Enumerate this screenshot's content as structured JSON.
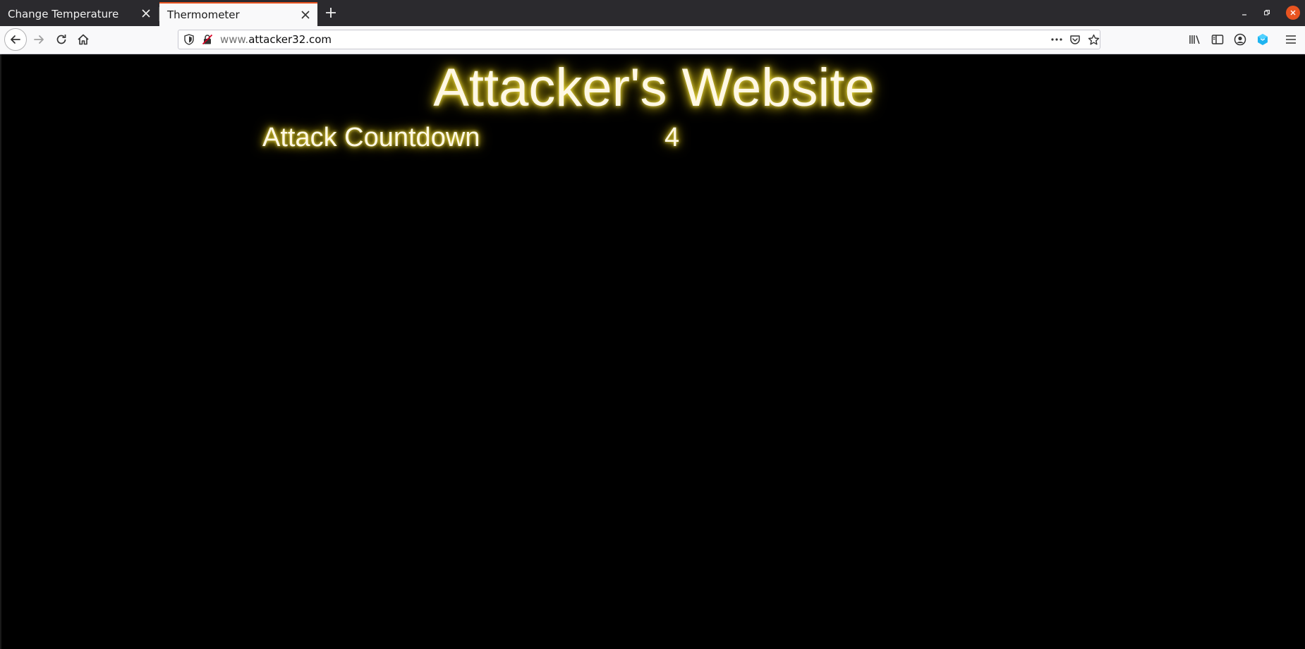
{
  "browser": {
    "tabs": [
      {
        "title": "Change Temperature",
        "active": false
      },
      {
        "title": "Thermometer",
        "active": true
      }
    ],
    "url": {
      "prefix": "www.",
      "domain": "attacker32.com"
    },
    "icons": {
      "back": "arrow-left-icon",
      "forward": "arrow-right-icon",
      "reload": "reload-icon",
      "home": "home-icon",
      "tracking": "shield-icon",
      "insecure": "insecure-lock-icon",
      "page_actions": "more-dots-icon",
      "pocket": "pocket-icon",
      "bookmark": "star-icon",
      "library": "library-icon",
      "sidebar": "sidebar-icon",
      "account": "account-icon",
      "extension": "extension-icon",
      "menu": "hamburger-menu-icon"
    },
    "accent_color": "#e95420"
  },
  "page": {
    "title": "Attacker's Website",
    "countdown_label": "Attack Countdown",
    "countdown_value": "4",
    "background_color": "#000000",
    "text_color": "#fff8e4",
    "glow_color": "#f5e44a"
  }
}
